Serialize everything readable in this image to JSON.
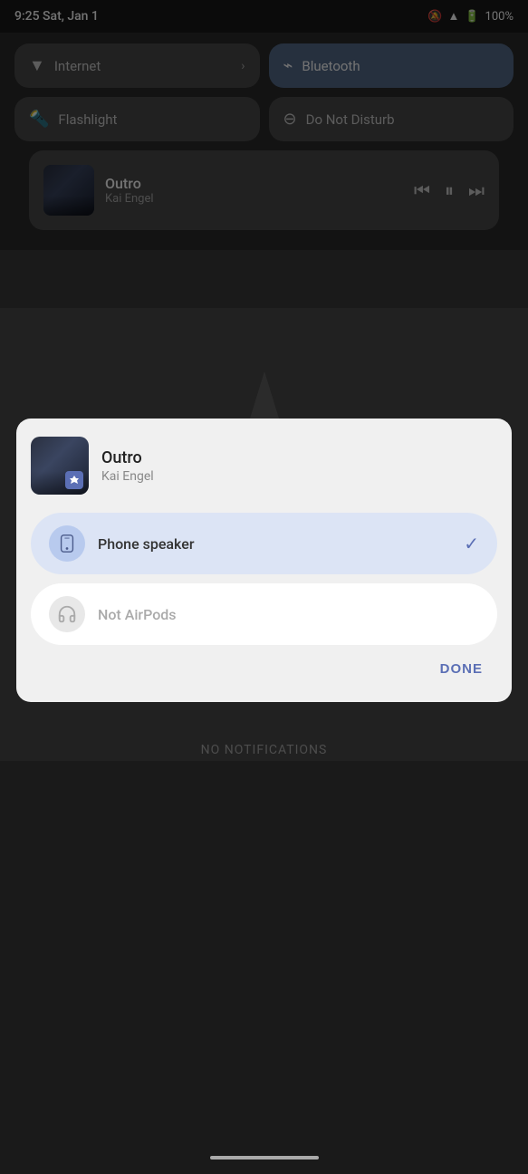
{
  "statusBar": {
    "time": "9:25 Sat, Jan 1",
    "battery": "100%",
    "icons": [
      "mute-icon",
      "wifi-icon",
      "battery-icon"
    ]
  },
  "quickSettings": {
    "tiles": [
      {
        "id": "internet",
        "label": "Internet",
        "icon": "wifi",
        "active": false,
        "hasArrow": true
      },
      {
        "id": "bluetooth",
        "label": "Bluetooth",
        "icon": "bluetooth",
        "active": true,
        "hasArrow": false
      }
    ],
    "tiles2": [
      {
        "id": "flashlight",
        "label": "Flashlight",
        "icon": "flashlight",
        "active": false,
        "hasArrow": false
      },
      {
        "id": "dnd",
        "label": "Do Not Disturb",
        "icon": "dnd",
        "active": false,
        "hasArrow": false
      }
    ]
  },
  "mediaPlayer": {
    "title": "Outro",
    "artist": "Kai Engel",
    "controls": [
      "prev",
      "pause",
      "next"
    ]
  },
  "noNotifications": "NO NOTIFICATIONS",
  "dialog": {
    "song": {
      "title": "Outro",
      "artist": "Kai Engel"
    },
    "options": [
      {
        "id": "phone-speaker",
        "label": "Phone speaker",
        "icon": "phone",
        "selected": true
      },
      {
        "id": "not-airpods",
        "label": "Not AirPods",
        "icon": "headphones",
        "selected": false
      }
    ],
    "doneLabel": "DONE"
  }
}
